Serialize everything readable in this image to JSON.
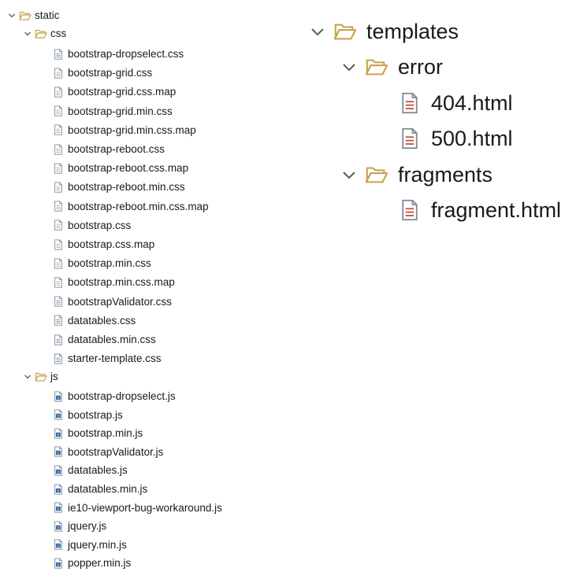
{
  "left_tree": {
    "static": {
      "label": "static"
    },
    "css": {
      "label": "css",
      "files": [
        {
          "label": "bootstrap-dropselect.css",
          "icon": "css-file-icon"
        },
        {
          "label": "bootstrap-grid.css",
          "icon": "generic-file-icon"
        },
        {
          "label": "bootstrap-grid.css.map",
          "icon": "generic-file-icon"
        },
        {
          "label": "bootstrap-grid.min.css",
          "icon": "generic-file-icon"
        },
        {
          "label": "bootstrap-grid.min.css.map",
          "icon": "generic-file-icon"
        },
        {
          "label": "bootstrap-reboot.css",
          "icon": "generic-file-icon"
        },
        {
          "label": "bootstrap-reboot.css.map",
          "icon": "generic-file-icon"
        },
        {
          "label": "bootstrap-reboot.min.css",
          "icon": "generic-file-icon"
        },
        {
          "label": "bootstrap-reboot.min.css.map",
          "icon": "generic-file-icon"
        },
        {
          "label": "bootstrap.css",
          "icon": "generic-file-icon"
        },
        {
          "label": "bootstrap.css.map",
          "icon": "generic-file-icon"
        },
        {
          "label": "bootstrap.min.css",
          "icon": "generic-file-icon"
        },
        {
          "label": "bootstrap.min.css.map",
          "icon": "generic-file-icon"
        },
        {
          "label": "bootstrapValidator.css",
          "icon": "css-file-icon"
        },
        {
          "label": "datatables.css",
          "icon": "css-file-icon"
        },
        {
          "label": "datatables.min.css",
          "icon": "css-file-icon"
        },
        {
          "label": "starter-template.css",
          "icon": "css-file-icon"
        }
      ]
    },
    "js": {
      "label": "js",
      "files": [
        {
          "label": "bootstrap-dropselect.js",
          "icon": "js-file-icon"
        },
        {
          "label": "bootstrap.js",
          "icon": "js-file-icon"
        },
        {
          "label": "bootstrap.min.js",
          "icon": "js-file-icon"
        },
        {
          "label": "bootstrapValidator.js",
          "icon": "js-file-icon"
        },
        {
          "label": "datatables.js",
          "icon": "js-file-icon"
        },
        {
          "label": "datatables.min.js",
          "icon": "js-file-icon"
        },
        {
          "label": "ie10-viewport-bug-workaround.js",
          "icon": "js-file-icon"
        },
        {
          "label": "jquery.js",
          "icon": "js-file-icon"
        },
        {
          "label": "jquery.min.js",
          "icon": "js-file-icon"
        },
        {
          "label": "popper.min.js",
          "icon": "js-file-icon"
        }
      ]
    }
  },
  "right_tree": {
    "templates": {
      "label": "templates"
    },
    "error": {
      "label": "error",
      "files": [
        {
          "label": "404.html",
          "icon": "html-file-icon"
        },
        {
          "label": "500.html",
          "icon": "html-file-icon"
        }
      ]
    },
    "fragments": {
      "label": "fragments",
      "files": [
        {
          "label": "fragment.html",
          "icon": "html-file-icon"
        }
      ]
    }
  },
  "colors": {
    "folder": "#c9a04a",
    "chevron": "#5a5a5a",
    "file_outline": "#7b8794",
    "css_lines": "#6a8bb0",
    "js_badge": "#3d6fa8",
    "html_lines": "#c04a3a"
  }
}
